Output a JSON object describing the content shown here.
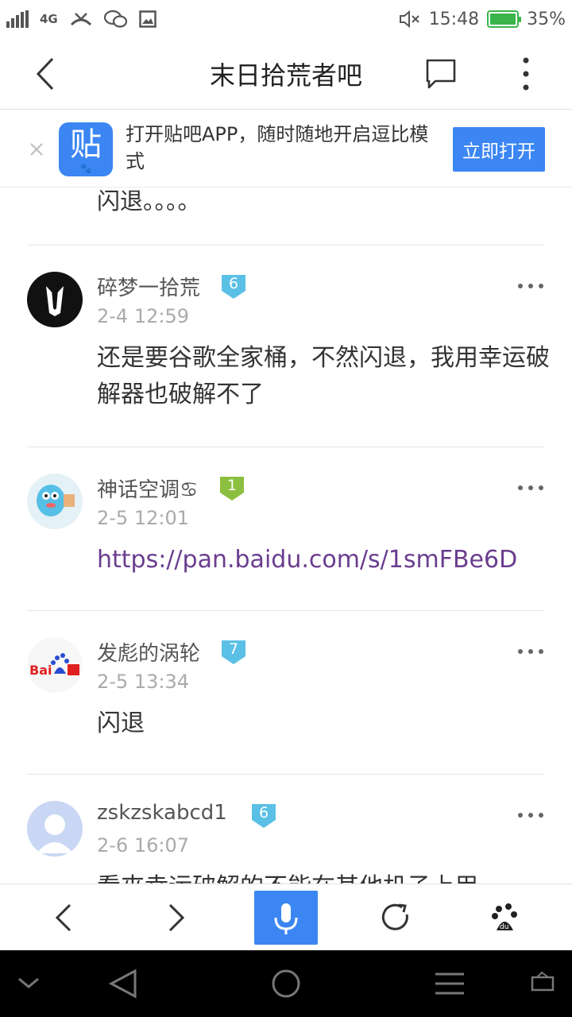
{
  "status_bar": {
    "network": "4G",
    "time": "15:48",
    "battery": "35%",
    "battery_level": 0.35,
    "colors": {
      "battery": "#3ab54a"
    }
  },
  "header": {
    "title": "末日拾荒者吧"
  },
  "banner": {
    "logo_text": "贴",
    "message": "打开贴吧APP，随时随地开启逗比模式",
    "open_button": "立即打开"
  },
  "previous_post_tail": "闪退。。。。",
  "posts": [
    {
      "username": "碎梦一拾荒",
      "level": "6",
      "level_color": "#5bc0e6",
      "time": "2-4 12:59",
      "text": "还是要谷歌全家桶，不然闪退，我用幸运破解器也破解不了"
    },
    {
      "username": "神话空调♋",
      "level": "1",
      "level_color": "#8cbf3f",
      "time": "2-5 12:01",
      "text": "https://pan.baidu.com/s/1smFBe6D"
    },
    {
      "username": "发彪的涡轮",
      "level": "7",
      "level_color": "#5bc0e6",
      "time": "2-5 13:34",
      "text": "闪退"
    },
    {
      "username": "zskzskabcd1",
      "level": "6",
      "level_color": "#5bc0e6",
      "time": "2-6 16:07",
      "text": "看來幸运破解的不能在其他机子上用"
    }
  ],
  "colors": {
    "accent": "#3b86f3",
    "link": "#6a3d8f"
  }
}
